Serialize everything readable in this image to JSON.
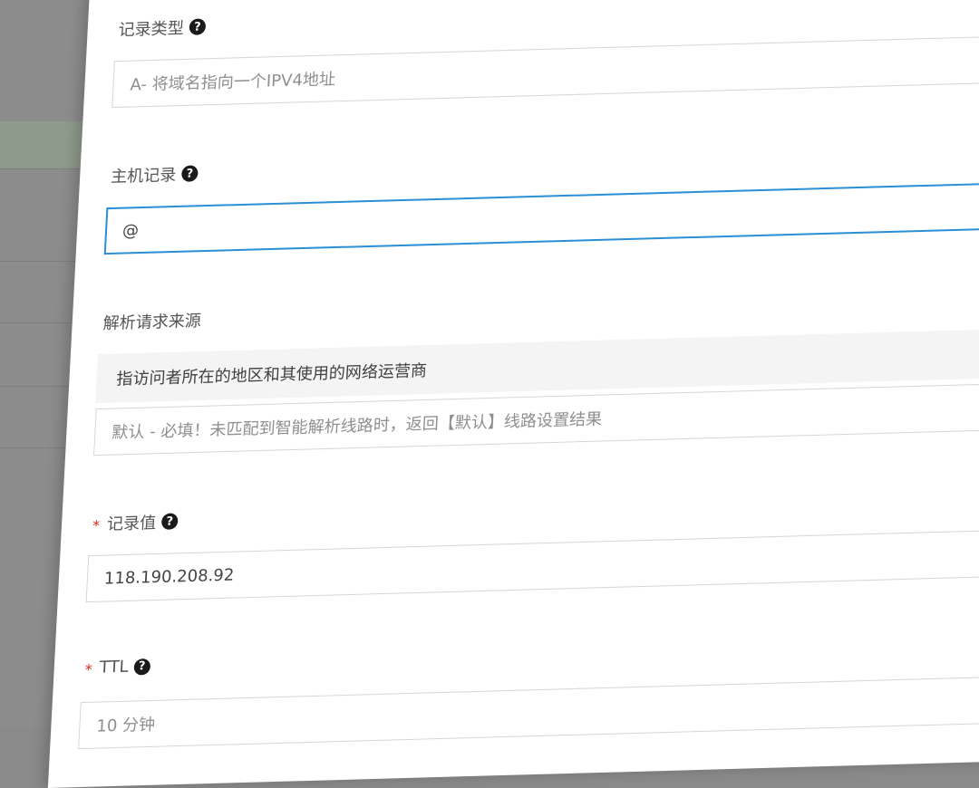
{
  "form": {
    "record_type": {
      "label": "记录类型",
      "help": "?",
      "value": "A- 将域名指向一个IPV4地址"
    },
    "host_record": {
      "label": "主机记录",
      "help": "?",
      "value": "@"
    },
    "resolve_source": {
      "label": "解析请求来源",
      "hint": "指访问者所在的地区和其使用的网络运营商",
      "value": "默认 - 必填！未匹配到智能解析线路时，返回【默认】线路设置结果"
    },
    "record_value": {
      "required": "*",
      "label": "记录值",
      "help": "?",
      "value": "118.190.208.92"
    },
    "ttl": {
      "required": "*",
      "label": "TTL",
      "help": "?",
      "value": "10 分钟"
    }
  },
  "colors": {
    "accent": "#2a8fd6",
    "required": "#d9281b",
    "backdrop": "#8c8c8c"
  }
}
